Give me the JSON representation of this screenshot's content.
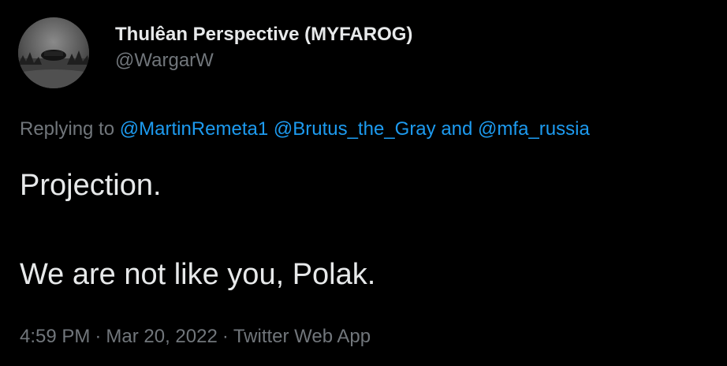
{
  "author": {
    "display_name": "Thulêan Perspective (MYFAROG)",
    "handle": "@WargarW",
    "avatar_icon": "profile-photo"
  },
  "reply": {
    "prefix": "Replying to",
    "mentions": [
      "@MartinRemeta1",
      "@Brutus_the_Gray"
    ],
    "conjunction": "and",
    "last_mention": "@mfa_russia"
  },
  "body": {
    "line1": "Projection.",
    "line2": "We are not like you, Polak."
  },
  "meta": {
    "time": "4:59 PM",
    "separator": "·",
    "date": "Mar 20, 2022",
    "source": "Twitter Web App"
  },
  "colors": {
    "background": "#000000",
    "text": "#e7e9ea",
    "muted": "#71767b",
    "link": "#1d9bf0"
  }
}
